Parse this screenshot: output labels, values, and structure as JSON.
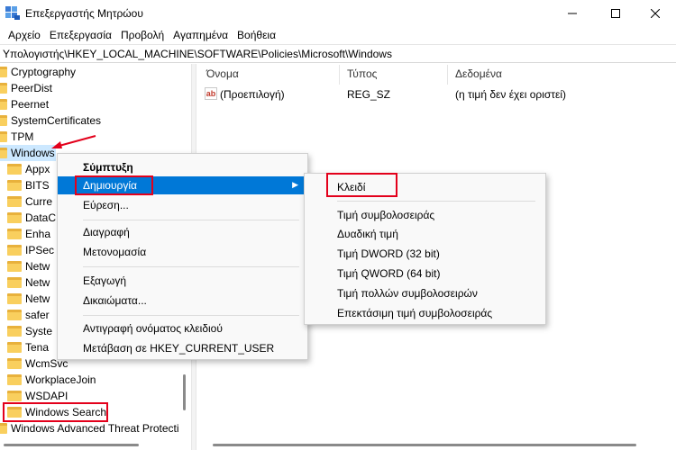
{
  "window": {
    "title": "Επεξεργαστής Μητρώου"
  },
  "menubar": [
    "Αρχείο",
    "Επεξεργασία",
    "Προβολή",
    "Αγαπημένα",
    "Βοήθεια"
  ],
  "address": "Υπολογιστής\\HKEY_LOCAL_MACHINE\\SOFTWARE\\Policies\\Microsoft\\Windows",
  "tree": {
    "items": [
      "Cryptography",
      "PeerDist",
      "Peernet",
      "SystemCertificates",
      "TPM",
      "Windows",
      "Appx",
      "BITS",
      "Curre",
      "DataC",
      "Enha",
      "IPSec",
      "Netw",
      "Netw",
      "Netw",
      "safer",
      "Syste",
      "Tena",
      "WcmSvc",
      "WorkplaceJoin",
      "WSDAPI",
      "Windows Search",
      "Windows Advanced Threat Protecti"
    ]
  },
  "columns": {
    "name": "Όνομα",
    "type": "Τύπος",
    "data": "Δεδομένα"
  },
  "values": [
    {
      "icon": "ab",
      "name": "(Προεπιλογή)",
      "type": "REG_SZ",
      "data": "(η τιμή δεν έχει οριστεί)"
    }
  ],
  "context_menu": {
    "collapse": "Σύμπτυξη",
    "new": "Δημιουργία",
    "find": "Εύρεση...",
    "delete": "Διαγραφή",
    "rename": "Μετονομασία",
    "export": "Εξαγωγή",
    "permissions": "Δικαιώματα...",
    "copy_key_name": "Αντιγραφή ονόματος κλειδιού",
    "goto_hkcu": "Μετάβαση σε HKEY_CURRENT_USER"
  },
  "submenu": {
    "key": "Κλειδί",
    "string": "Τιμή συμβολοσειράς",
    "binary": "Δυαδική τιμή",
    "dword": "Τιμή DWORD (32 bit)",
    "qword": "Τιμή QWORD (64 bit)",
    "multi_string": "Τιμή πολλών συμβολοσειρών",
    "expandable_string": "Επεκτάσιμη τιμή συμβολοσειράς"
  },
  "colors": {
    "highlight": "#0078d7",
    "annotation": "#e3001b",
    "folder": "#f9cf5e"
  }
}
